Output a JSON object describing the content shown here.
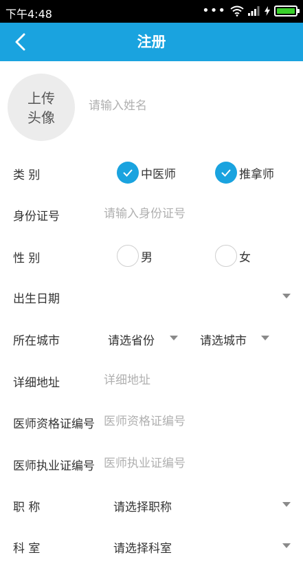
{
  "status_bar": {
    "time": "下午4:48"
  },
  "header": {
    "title": "注册"
  },
  "avatar": {
    "label": "上传\n头像"
  },
  "name": {
    "placeholder": "请输入姓名"
  },
  "form": {
    "category": {
      "label": "类  别",
      "options": [
        "中医师",
        "推拿师"
      ]
    },
    "id_number": {
      "label": "身份证号",
      "placeholder": "请输入身份证号"
    },
    "gender": {
      "label": "性  别",
      "options": [
        "男",
        "女"
      ]
    },
    "birth_date": {
      "label": "出生日期"
    },
    "city": {
      "label": "所在城市",
      "province_placeholder": "请选省份",
      "city_placeholder": "请选城市"
    },
    "address": {
      "label": "详细地址",
      "placeholder": "详细地址"
    },
    "qualification": {
      "label": "医师资格证编号",
      "placeholder": "医师资格证编号"
    },
    "practice": {
      "label": "医师执业证编号",
      "placeholder": "医师执业证编号"
    },
    "title": {
      "label": "职  称",
      "placeholder": "请选择职称"
    },
    "department": {
      "label": "科  室",
      "placeholder": "请选择科室"
    }
  },
  "colors": {
    "primary": "#1aa3df",
    "status_bar": "#000000",
    "battery": "#39d02a"
  }
}
